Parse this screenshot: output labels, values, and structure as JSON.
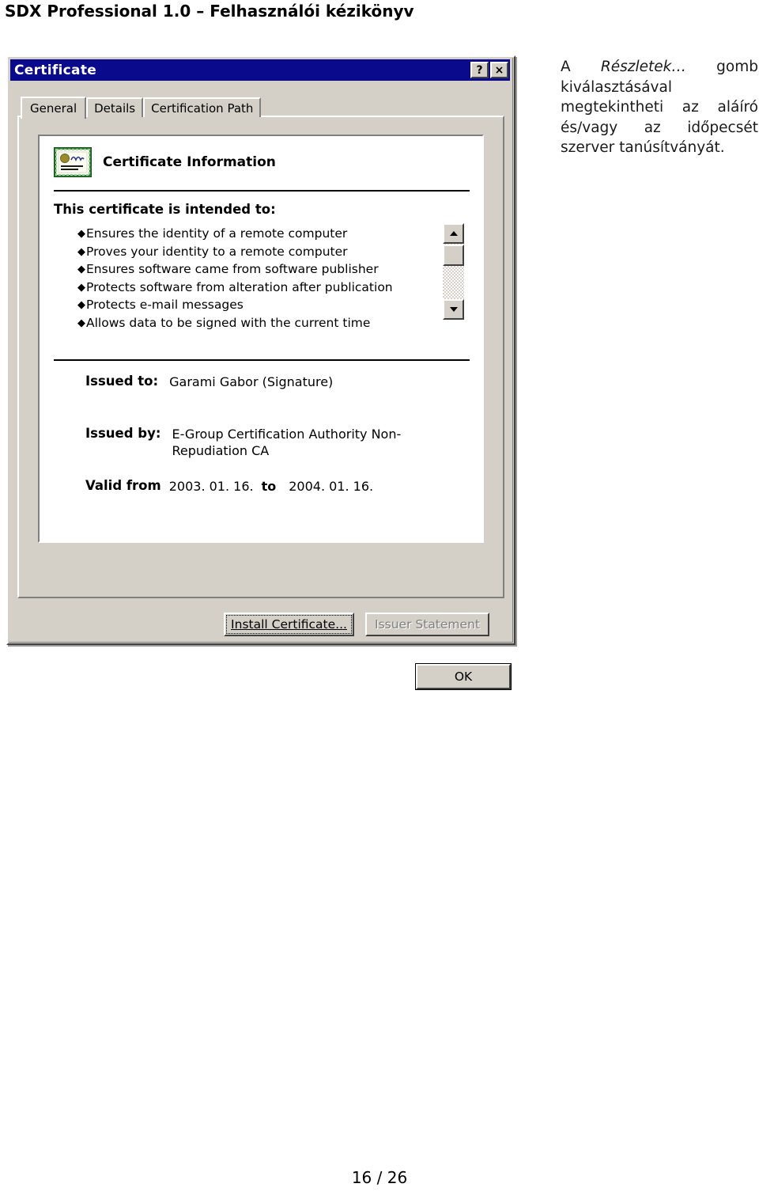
{
  "page": {
    "header": "SDX Professional 1.0 – Felhasználói kézikönyv",
    "footer": "16 / 26"
  },
  "side_note": {
    "line1_pre": "A",
    "line1_italic": "Részletek…",
    "line1_post": "gomb",
    "line2": "kiválasztásával",
    "line3": "megtekintheti az aláíró",
    "line4": "és/vagy az időpecsét",
    "line5": "szerver tanúsítványát."
  },
  "dialog": {
    "title": "Certificate",
    "titlebar_buttons": {
      "help": "?",
      "close": "×"
    },
    "tabs": [
      {
        "label": "General",
        "active": true
      },
      {
        "label": "Details",
        "active": false
      },
      {
        "label": "Certification Path",
        "active": false
      }
    ],
    "info": {
      "heading": "Certificate Information",
      "intended_label": "This certificate is intended to:",
      "purposes": [
        "Ensures the identity of a remote computer",
        "Proves your identity to a remote computer",
        "Ensures software came from software publisher",
        "Protects software from alteration after publication",
        "Protects e-mail messages",
        "Allows data to be signed with the current time"
      ],
      "issued_to_label": "Issued to:",
      "issued_to_value": "Garami Gabor (Signature)",
      "issued_by_label": "Issued by:",
      "issued_by_value": "E-Group Certification Authority Non-Repudiation CA",
      "valid_from_label": "Valid from",
      "valid_from_value": "2003. 01. 16.",
      "valid_to_label": "to",
      "valid_to_value": "2004. 01. 16."
    },
    "buttons": {
      "install": "Install Certificate...",
      "issuer": "Issuer Statement",
      "ok": "OK"
    }
  },
  "colors": {
    "titlebar": "#0a0a8c",
    "dialog_face": "#d4d0c8",
    "panel": "#ffffff",
    "disabled_text": "#808080"
  }
}
